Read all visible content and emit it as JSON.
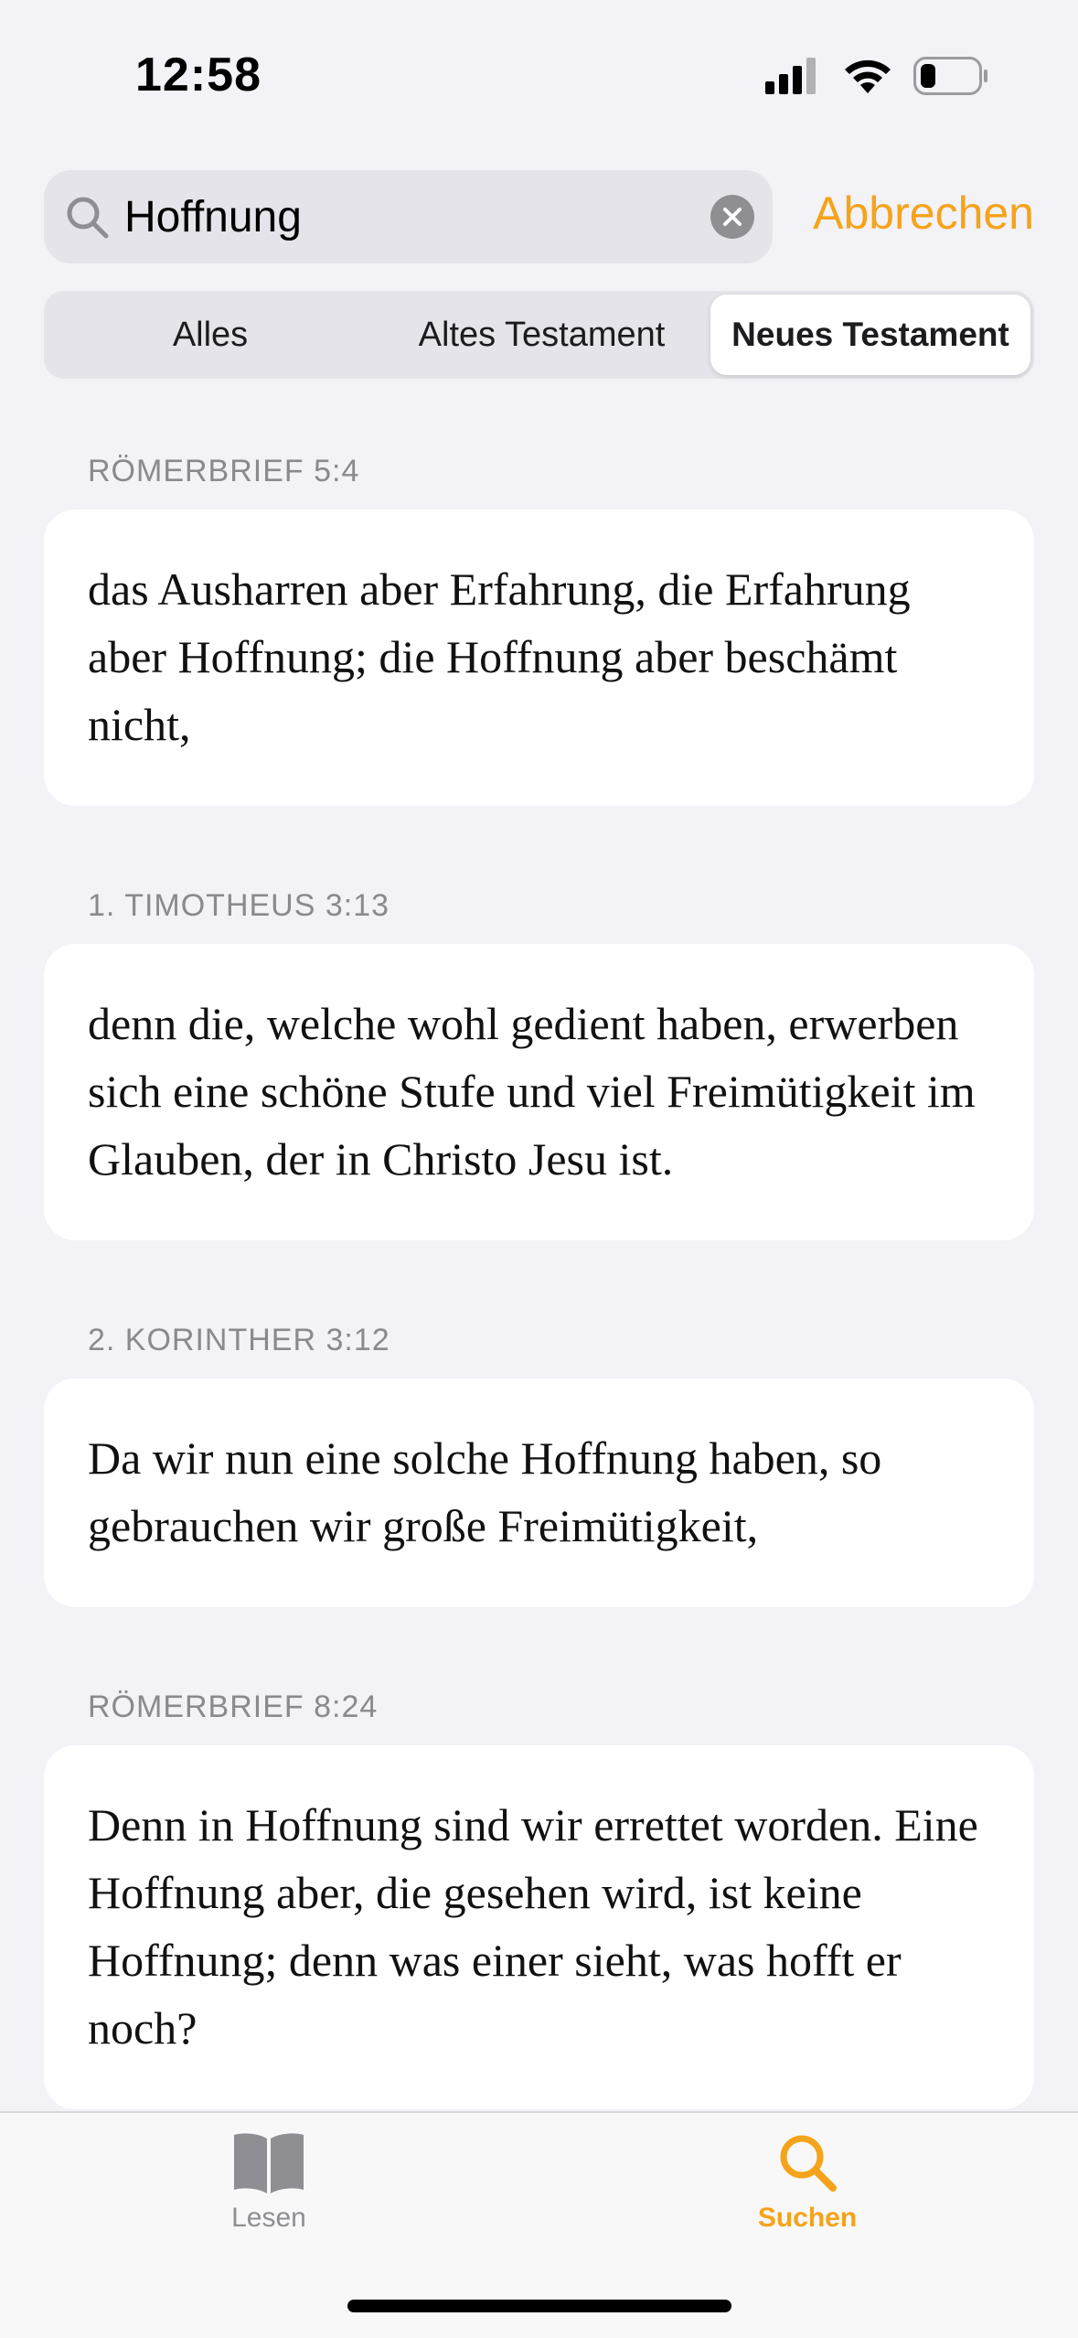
{
  "status": {
    "time": "12:58"
  },
  "search": {
    "value": "Hoffnung",
    "cancel_label": "Abbrechen"
  },
  "segments": [
    {
      "label": "Alles",
      "active": false
    },
    {
      "label": "Altes Testament",
      "active": false
    },
    {
      "label": "Neues Testament",
      "active": true
    }
  ],
  "results": [
    {
      "reference": "RÖMERBRIEF 5:4",
      "text": "das Ausharren aber Erfahrung, die Erfahrung aber Hoffnung; die Hoffnung aber beschämt nicht,"
    },
    {
      "reference": "1. TIMOTHEUS 3:13",
      "text": "denn die, welche wohl gedient haben, erwerben sich eine schöne Stufe und viel Freimütigkeit im Glauben, der in Christo Jesu ist."
    },
    {
      "reference": "2. KORINTHER 3:12",
      "text": "Da wir nun eine solche Hoffnung haben, so gebrauchen wir große Freimütigkeit,"
    },
    {
      "reference": "RÖMERBRIEF 8:24",
      "text": "Denn in Hoffnung sind wir errettet worden. Eine Hoffnung aber, die gesehen wird, ist keine Hoffnung; denn was einer sieht, was hofft er noch?"
    }
  ],
  "tabbar": {
    "read_label": "Lesen",
    "search_label": "Suchen"
  },
  "colors": {
    "accent": "#F5A31A",
    "background": "#F2F2F7",
    "card": "#FFFFFF",
    "secondary_text": "#8A8A8E"
  },
  "icons": {
    "search": "search-icon",
    "clear": "clear-icon",
    "book": "book-icon",
    "signal": "cellular-signal-icon",
    "wifi": "wifi-icon",
    "battery": "battery-icon"
  }
}
